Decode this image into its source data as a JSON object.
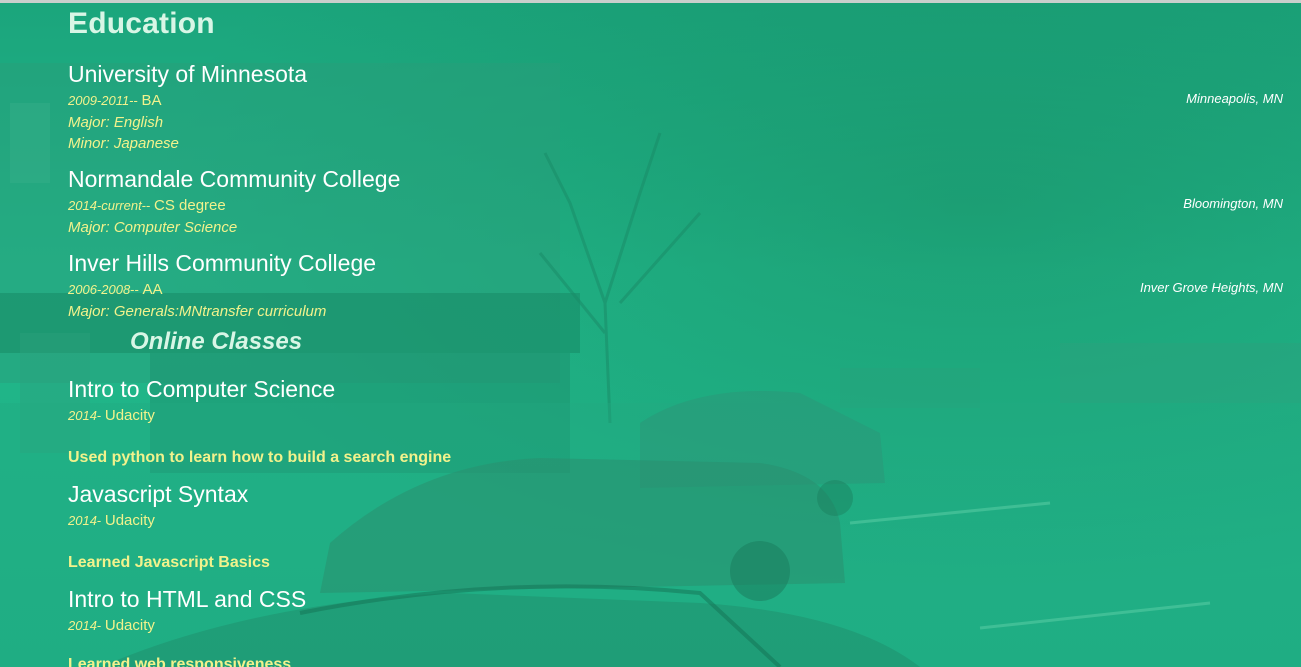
{
  "education": {
    "heading": "Education",
    "schools": [
      {
        "name": "University of Minnesota",
        "years": "2009-2011",
        "sep": "-- ",
        "degree": "BA",
        "lines": [
          "Major: English",
          "Minor: Japanese"
        ],
        "location": "Minneapolis, MN"
      },
      {
        "name": "Normandale Community College",
        "years": "2014-current",
        "sep": "-- ",
        "degree": "CS degree",
        "lines": [
          "Major: Computer Science"
        ],
        "location": "Bloomington, MN"
      },
      {
        "name": "Inver Hills Community College",
        "years": "2006-2008",
        "sep": "-- ",
        "degree": "AA",
        "lines": [
          "Major: Generals:MNtransfer curriculum"
        ],
        "location": "Inver Grove Heights, MN"
      }
    ]
  },
  "online": {
    "heading": "Online Classes",
    "classes": [
      {
        "name": "Intro to Computer Science",
        "years": "2014",
        "sep": "- ",
        "provider": "Udacity",
        "description": "Used python to learn how to build a search engine"
      },
      {
        "name": "Javascript Syntax",
        "years": "2014",
        "sep": "- ",
        "provider": "Udacity",
        "description": "Learned Javascript Basics"
      },
      {
        "name": "Intro to HTML and CSS",
        "years": "2014",
        "sep": "- ",
        "provider": "Udacity",
        "description": "Learned web responsiveness"
      }
    ]
  },
  "colors": {
    "overlay": "#1fb487",
    "heading": "#d8f6e6",
    "accent_yellow": "#f2f28c",
    "white": "#ffffff"
  }
}
